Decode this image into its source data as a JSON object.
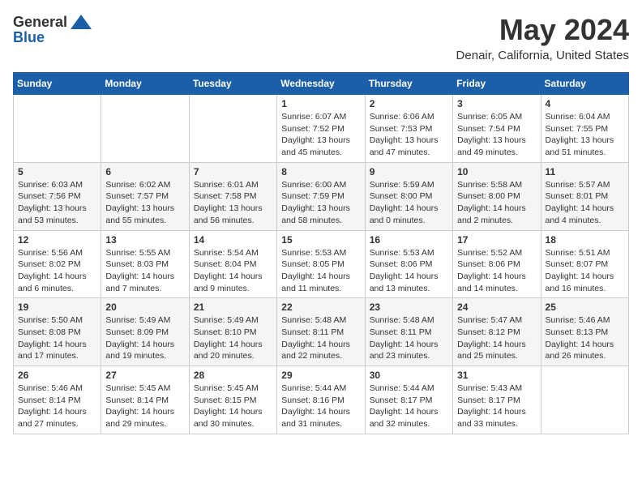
{
  "header": {
    "logo_line1": "General",
    "logo_line2": "Blue",
    "main_title": "May 2024",
    "subtitle": "Denair, California, United States"
  },
  "calendar": {
    "days_of_week": [
      "Sunday",
      "Monday",
      "Tuesday",
      "Wednesday",
      "Thursday",
      "Friday",
      "Saturday"
    ],
    "weeks": [
      {
        "days": [
          {
            "num": "",
            "info": ""
          },
          {
            "num": "",
            "info": ""
          },
          {
            "num": "",
            "info": ""
          },
          {
            "num": "1",
            "info": "Sunrise: 6:07 AM\nSunset: 7:52 PM\nDaylight: 13 hours\nand 45 minutes."
          },
          {
            "num": "2",
            "info": "Sunrise: 6:06 AM\nSunset: 7:53 PM\nDaylight: 13 hours\nand 47 minutes."
          },
          {
            "num": "3",
            "info": "Sunrise: 6:05 AM\nSunset: 7:54 PM\nDaylight: 13 hours\nand 49 minutes."
          },
          {
            "num": "4",
            "info": "Sunrise: 6:04 AM\nSunset: 7:55 PM\nDaylight: 13 hours\nand 51 minutes."
          }
        ]
      },
      {
        "days": [
          {
            "num": "5",
            "info": "Sunrise: 6:03 AM\nSunset: 7:56 PM\nDaylight: 13 hours\nand 53 minutes."
          },
          {
            "num": "6",
            "info": "Sunrise: 6:02 AM\nSunset: 7:57 PM\nDaylight: 13 hours\nand 55 minutes."
          },
          {
            "num": "7",
            "info": "Sunrise: 6:01 AM\nSunset: 7:58 PM\nDaylight: 13 hours\nand 56 minutes."
          },
          {
            "num": "8",
            "info": "Sunrise: 6:00 AM\nSunset: 7:59 PM\nDaylight: 13 hours\nand 58 minutes."
          },
          {
            "num": "9",
            "info": "Sunrise: 5:59 AM\nSunset: 8:00 PM\nDaylight: 14 hours\nand 0 minutes."
          },
          {
            "num": "10",
            "info": "Sunrise: 5:58 AM\nSunset: 8:00 PM\nDaylight: 14 hours\nand 2 minutes."
          },
          {
            "num": "11",
            "info": "Sunrise: 5:57 AM\nSunset: 8:01 PM\nDaylight: 14 hours\nand 4 minutes."
          }
        ]
      },
      {
        "days": [
          {
            "num": "12",
            "info": "Sunrise: 5:56 AM\nSunset: 8:02 PM\nDaylight: 14 hours\nand 6 minutes."
          },
          {
            "num": "13",
            "info": "Sunrise: 5:55 AM\nSunset: 8:03 PM\nDaylight: 14 hours\nand 7 minutes."
          },
          {
            "num": "14",
            "info": "Sunrise: 5:54 AM\nSunset: 8:04 PM\nDaylight: 14 hours\nand 9 minutes."
          },
          {
            "num": "15",
            "info": "Sunrise: 5:53 AM\nSunset: 8:05 PM\nDaylight: 14 hours\nand 11 minutes."
          },
          {
            "num": "16",
            "info": "Sunrise: 5:53 AM\nSunset: 8:06 PM\nDaylight: 14 hours\nand 13 minutes."
          },
          {
            "num": "17",
            "info": "Sunrise: 5:52 AM\nSunset: 8:06 PM\nDaylight: 14 hours\nand 14 minutes."
          },
          {
            "num": "18",
            "info": "Sunrise: 5:51 AM\nSunset: 8:07 PM\nDaylight: 14 hours\nand 16 minutes."
          }
        ]
      },
      {
        "days": [
          {
            "num": "19",
            "info": "Sunrise: 5:50 AM\nSunset: 8:08 PM\nDaylight: 14 hours\nand 17 minutes."
          },
          {
            "num": "20",
            "info": "Sunrise: 5:49 AM\nSunset: 8:09 PM\nDaylight: 14 hours\nand 19 minutes."
          },
          {
            "num": "21",
            "info": "Sunrise: 5:49 AM\nSunset: 8:10 PM\nDaylight: 14 hours\nand 20 minutes."
          },
          {
            "num": "22",
            "info": "Sunrise: 5:48 AM\nSunset: 8:11 PM\nDaylight: 14 hours\nand 22 minutes."
          },
          {
            "num": "23",
            "info": "Sunrise: 5:48 AM\nSunset: 8:11 PM\nDaylight: 14 hours\nand 23 minutes."
          },
          {
            "num": "24",
            "info": "Sunrise: 5:47 AM\nSunset: 8:12 PM\nDaylight: 14 hours\nand 25 minutes."
          },
          {
            "num": "25",
            "info": "Sunrise: 5:46 AM\nSunset: 8:13 PM\nDaylight: 14 hours\nand 26 minutes."
          }
        ]
      },
      {
        "days": [
          {
            "num": "26",
            "info": "Sunrise: 5:46 AM\nSunset: 8:14 PM\nDaylight: 14 hours\nand 27 minutes."
          },
          {
            "num": "27",
            "info": "Sunrise: 5:45 AM\nSunset: 8:14 PM\nDaylight: 14 hours\nand 29 minutes."
          },
          {
            "num": "28",
            "info": "Sunrise: 5:45 AM\nSunset: 8:15 PM\nDaylight: 14 hours\nand 30 minutes."
          },
          {
            "num": "29",
            "info": "Sunrise: 5:44 AM\nSunset: 8:16 PM\nDaylight: 14 hours\nand 31 minutes."
          },
          {
            "num": "30",
            "info": "Sunrise: 5:44 AM\nSunset: 8:17 PM\nDaylight: 14 hours\nand 32 minutes."
          },
          {
            "num": "31",
            "info": "Sunrise: 5:43 AM\nSunset: 8:17 PM\nDaylight: 14 hours\nand 33 minutes."
          },
          {
            "num": "",
            "info": ""
          }
        ]
      }
    ]
  }
}
